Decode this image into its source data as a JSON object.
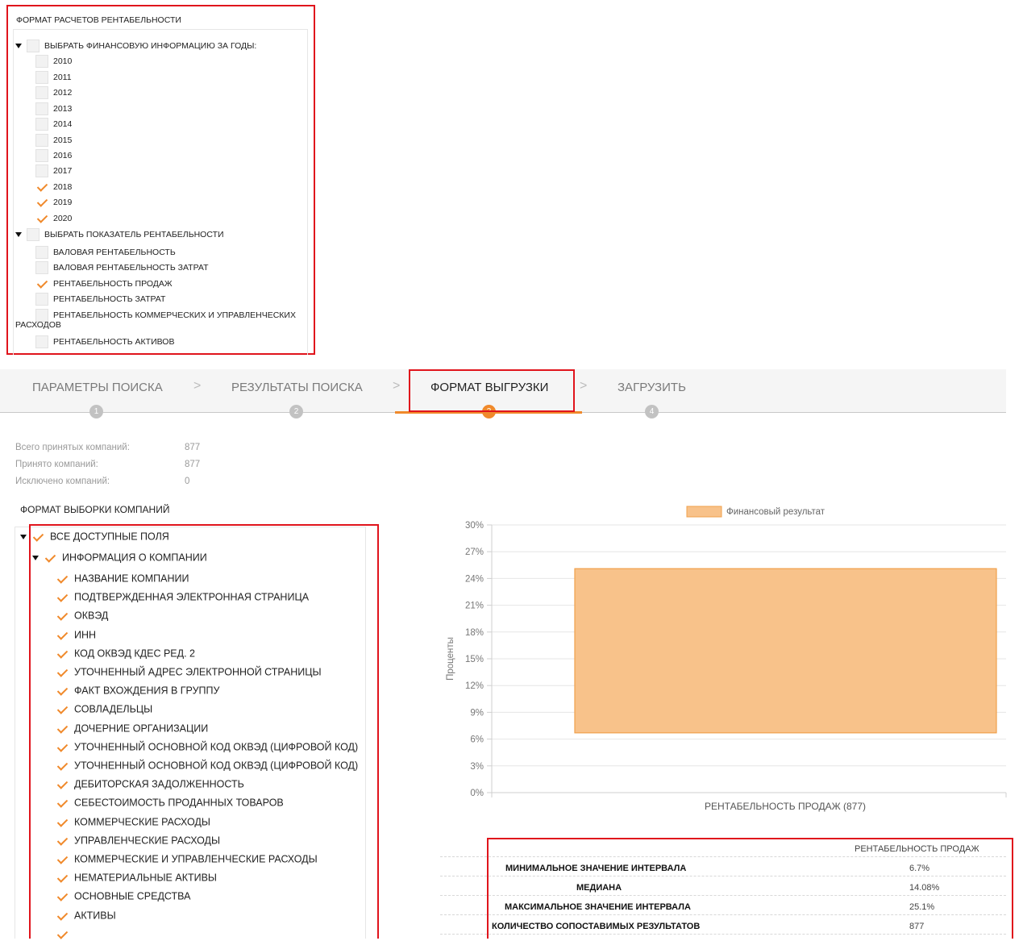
{
  "top_panel": {
    "title": "ФОРМАТ РАСЧЕТОВ РЕНТАБЕЛЬНОСТИ",
    "years_group": {
      "label": "ВЫБРАТЬ ФИНАНСОВУЮ ИНФОРМАЦИЮ ЗА ГОДЫ:",
      "items": [
        {
          "label": "2010",
          "checked": false
        },
        {
          "label": "2011",
          "checked": false
        },
        {
          "label": "2012",
          "checked": false
        },
        {
          "label": "2013",
          "checked": false
        },
        {
          "label": "2014",
          "checked": false
        },
        {
          "label": "2015",
          "checked": false
        },
        {
          "label": "2016",
          "checked": false
        },
        {
          "label": "2017",
          "checked": false
        },
        {
          "label": "2018",
          "checked": true
        },
        {
          "label": "2019",
          "checked": true
        },
        {
          "label": "2020",
          "checked": true
        }
      ]
    },
    "indicator_group": {
      "label": "ВЫБРАТЬ ПОКАЗАТЕЛЬ РЕНТАБЕЛЬНОСТИ",
      "items": [
        {
          "label": "ВАЛОВАЯ РЕНТАБЕЛЬНОСТЬ",
          "checked": false
        },
        {
          "label": "ВАЛОВАЯ РЕНТАБЕЛЬНОСТЬ ЗАТРАТ",
          "checked": false
        },
        {
          "label": "РЕНТАБЕЛЬНОСТЬ ПРОДАЖ",
          "checked": true
        },
        {
          "label": "РЕНТАБЕЛЬНОСТЬ ЗАТРАТ",
          "checked": false
        },
        {
          "label": "РЕНТАБЕЛЬНОСТЬ КОММЕРЧЕСКИХ И УПРАВЛЕНЧЕСКИХ",
          "label_cont": "РАСХОДОВ",
          "checked": false
        },
        {
          "label": "РЕНТАБЕЛЬНОСТЬ АКТИВОВ",
          "checked": false
        }
      ]
    }
  },
  "stepper": {
    "steps": [
      {
        "label": "ПАРАМЕТРЫ ПОИСКА",
        "number": "1"
      },
      {
        "label": "РЕЗУЛЬТАТЫ ПОИСКА",
        "number": "2"
      },
      {
        "label": "ФОРМАТ ВЫГРУЗКИ",
        "number": "3"
      },
      {
        "label": "ЗАГРУЗИТЬ",
        "number": "4"
      }
    ],
    "active_index": 2,
    "separator": ">"
  },
  "stats": {
    "total_label": "Всего принятых компаний:",
    "total_value": "877",
    "accepted_label": "Принято компаний:",
    "accepted_value": "877",
    "excluded_label": "Исключено компаний:",
    "excluded_value": "0"
  },
  "selection": {
    "title": "ФОРМАТ ВЫБОРКИ КОМПАНИЙ",
    "all_fields": "ВСЕ ДОСТУПНЫЕ ПОЛЯ",
    "company_info": "ИНФОРМАЦИЯ О КОМПАНИИ",
    "fields": [
      "НАЗВАНИЕ КОМПАНИИ",
      "ПОДТВЕРЖДЕННАЯ ЭЛЕКТРОННАЯ СТРАНИЦА",
      "ОКВЭД",
      "ИНН",
      "КОД ОКВЭД КДЕС РЕД. 2",
      "УТОЧНЕННЫЙ АДРЕС ЭЛЕКТРОННОЙ СТРАНИЦЫ",
      "ФАКТ ВХОЖДЕНИЯ В ГРУППУ",
      "СОВЛАДЕЛЬЦЫ",
      "ДОЧЕРНИЕ ОРГАНИЗАЦИИ",
      "УТОЧНЕННЫЙ ОСНОВНОЙ КОД ОКВЭД (ЦИФРОВОЙ КОД)",
      "УТОЧНЕННЫЙ ОСНОВНОЙ КОД ОКВЭД (ЦИФРОВОЙ КОД)",
      "ДЕБИТОРСКАЯ ЗАДОЛЖЕННОСТЬ",
      "СЕБЕСТОИМОСТЬ ПРОДАННЫХ ТОВАРОВ",
      "КОММЕРЧЕСКИЕ РАСХОДЫ",
      "УПРАВЛЕНЧЕСКИЕ РАСХОДЫ",
      "КОММЕРЧЕСКИЕ И УПРАВЛЕНЧЕСКИЕ РАСХОДЫ",
      "НЕМАТЕРИАЛЬНЫЕ АКТИВЫ",
      "ОСНОВНЫЕ СРЕДСТВА",
      "АКТИВЫ"
    ]
  },
  "chart_data": {
    "type": "bar",
    "categories": [
      "РЕНТАБЕЛЬНОСТЬ ПРОДАЖ (877)"
    ],
    "series": [
      {
        "name": "Финансовый результат",
        "low": 6.7,
        "high": 25.1
      }
    ],
    "ylabel": "Проценты",
    "ylim": [
      0,
      30
    ],
    "yticks": [
      0,
      3,
      6,
      9,
      12,
      15,
      18,
      21,
      24,
      27,
      30
    ],
    "ytick_labels": [
      "0%",
      "3%",
      "6%",
      "9%",
      "12%",
      "15%",
      "18%",
      "21%",
      "24%",
      "27%",
      "30%"
    ],
    "legend_position": "top",
    "grid": true,
    "colors": {
      "fill": "#f8c28a",
      "stroke": "#f0a04b"
    }
  },
  "results": {
    "column_header": "РЕНТАБЕЛЬНОСТЬ ПРОДАЖ",
    "rows": [
      {
        "label": "МИНИМАЛЬНОЕ ЗНАЧЕНИЕ ИНТЕРВАЛА",
        "value": "6.7%"
      },
      {
        "label": "МЕДИАНА",
        "value": "14.08%"
      },
      {
        "label": "МАКСИМАЛЬНОЕ ЗНАЧЕНИЕ ИНТЕРВАЛА",
        "value": "25.1%"
      },
      {
        "label": "КОЛИЧЕСТВО СОПОСТАВИМЫХ РЕЗУЛЬТАТОВ",
        "value": "877"
      }
    ]
  },
  "colors": {
    "accent": "#f0892b",
    "highlight_border": "#e0141c"
  }
}
